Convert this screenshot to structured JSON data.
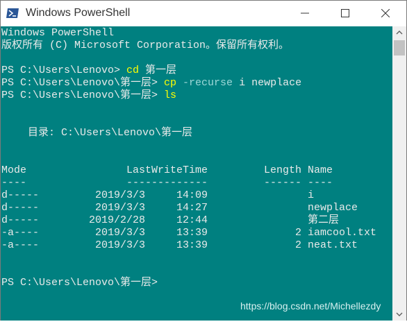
{
  "window": {
    "title": "Windows PowerShell",
    "colors": {
      "console_bg": "#008080",
      "text": "#eaeaea",
      "command": "#ffff00",
      "param": "#9fd8d8"
    }
  },
  "console": {
    "banner": {
      "line1": "Windows PowerShell",
      "line2": "版权所有 (C) Microsoft Corporation。保留所有权利。"
    },
    "commands": [
      {
        "prompt": "PS C:\\Users\\Lenovo> ",
        "cmd": "cd",
        "rest": " 第一层"
      },
      {
        "prompt": "PS C:\\Users\\Lenovo\\第一层> ",
        "cmd": "cp",
        "param": " -recurse",
        "rest": " i newplace"
      },
      {
        "prompt": "PS C:\\Users\\Lenovo\\第一层> ",
        "cmd": "ls",
        "rest": ""
      }
    ],
    "directory_label": "目录: C:\\Users\\Lenovo\\第一层",
    "table": {
      "headers": {
        "mode": "Mode",
        "lastwrite": "LastWriteTime",
        "length": "Length",
        "name": "Name"
      },
      "underlines": {
        "mode": "----",
        "lastwrite": "-------------",
        "length": "------",
        "name": "----"
      },
      "rows": [
        {
          "mode": "d-----",
          "date": "2019/3/3",
          "time": "14:09",
          "length": "",
          "name": "i"
        },
        {
          "mode": "d-----",
          "date": "2019/3/3",
          "time": "14:27",
          "length": "",
          "name": "newplace"
        },
        {
          "mode": "d-----",
          "date": "2019/2/28",
          "time": "12:44",
          "length": "",
          "name": "第二层"
        },
        {
          "mode": "-a----",
          "date": "2019/3/3",
          "time": "13:39",
          "length": "2",
          "name": "iamcool.txt"
        },
        {
          "mode": "-a----",
          "date": "2019/3/3",
          "time": "13:39",
          "length": "2",
          "name": "neat.txt"
        }
      ]
    },
    "final_prompt": "PS C:\\Users\\Lenovo\\第一层>"
  },
  "watermark": "https://blog.csdn.net/Michellezdy"
}
